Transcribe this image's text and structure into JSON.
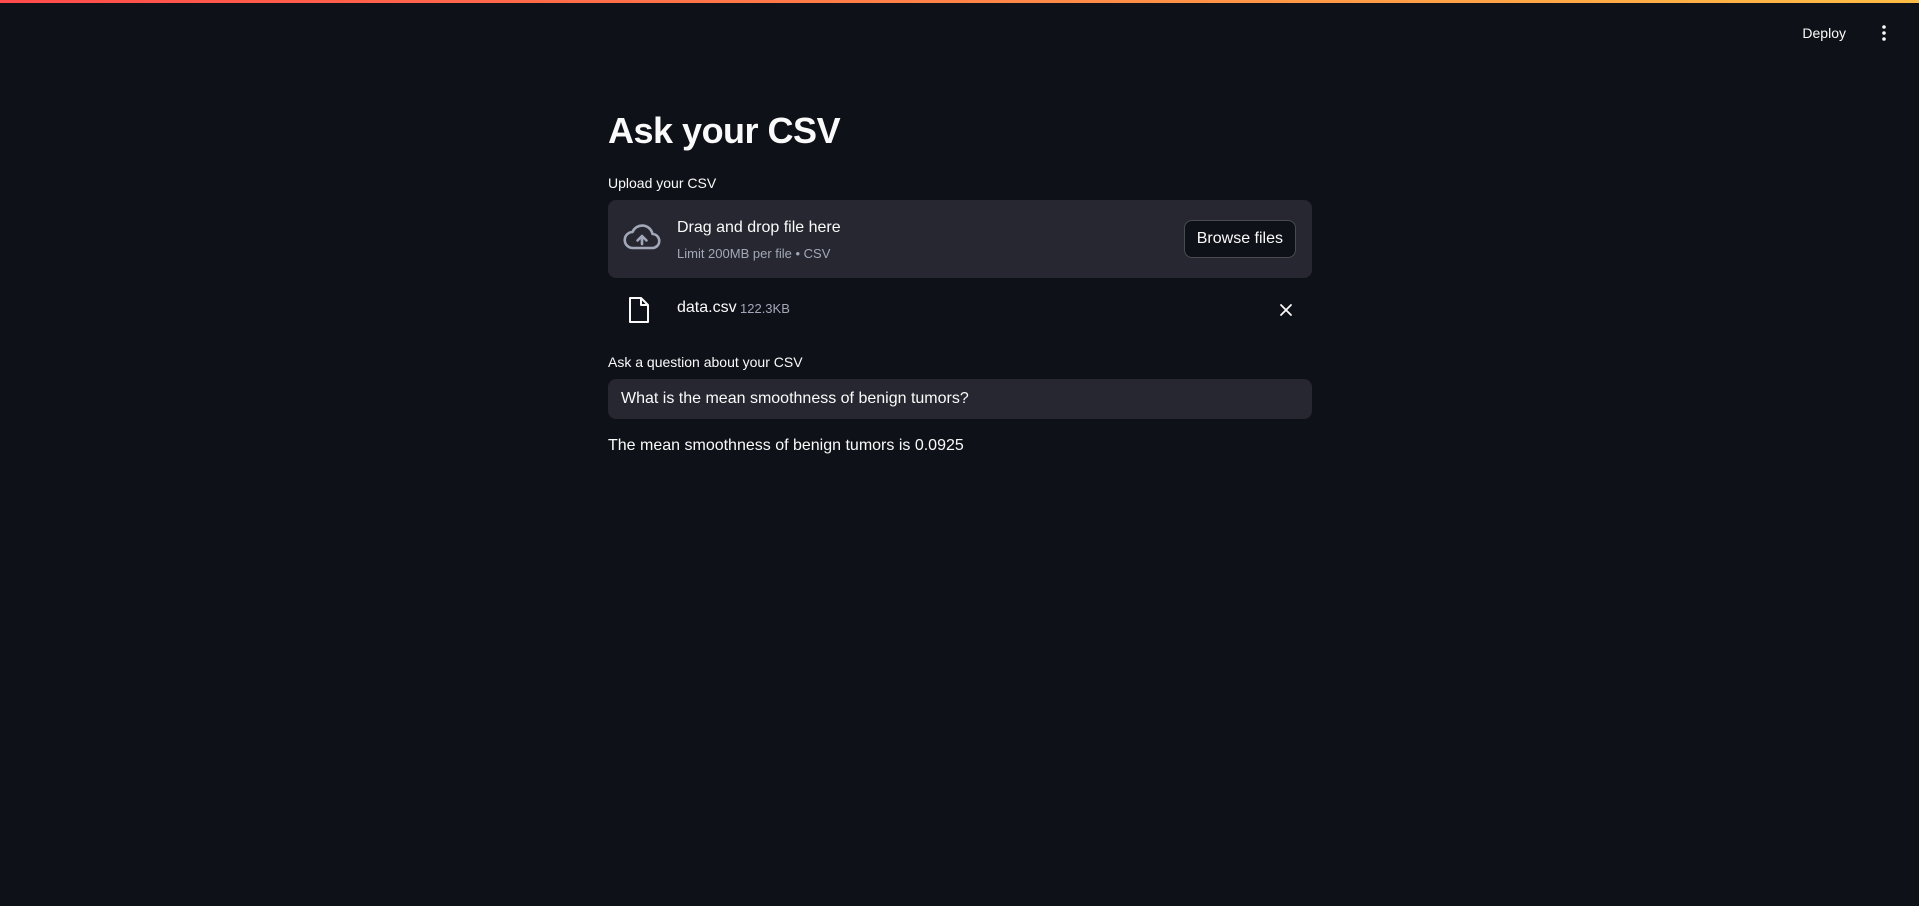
{
  "header": {
    "deploy_label": "Deploy",
    "menu_icon": "more-vertical-icon"
  },
  "main": {
    "title": "Ask your CSV",
    "uploader": {
      "label": "Upload your CSV",
      "dropzone_title": "Drag and drop file here",
      "dropzone_hint": "Limit 200MB per file • CSV",
      "browse_label": "Browse files",
      "icon": "cloud-upload-icon"
    },
    "uploaded_file": {
      "name": "data.csv",
      "size": "122.3KB",
      "icon": "file-icon",
      "remove_icon": "close-icon"
    },
    "question": {
      "label": "Ask a question about your CSV",
      "value": "What is the mean smoothness of benign tumors?"
    },
    "answer": "The mean smoothness of benign tumors is 0.0925"
  },
  "colors": {
    "background": "#0e1117",
    "widget_background": "#262730",
    "text": "#fafafa",
    "muted_text": "#a3a8b8",
    "accent_gradient_start": "#ff4b4b",
    "accent_gradient_end": "#ffbd45"
  }
}
